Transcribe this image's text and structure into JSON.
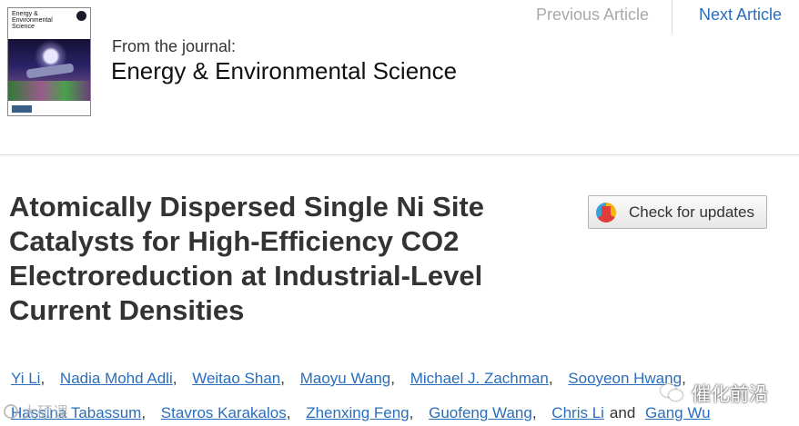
{
  "journal": {
    "cover_title": "Energy &\nEnvironmental\nScience",
    "from_label": "From the journal:",
    "name": "Energy & Environmental Science"
  },
  "nav": {
    "previous": "Previous Article",
    "next": "Next Article"
  },
  "article": {
    "title": "Atomically Dispersed Single Ni Site Catalysts for High-Efficiency CO2 Electroreduction at Industrial-Level Current Densities",
    "check_updates_label": "Check for updates"
  },
  "authors": {
    "list": [
      "Yi Li",
      "Nadia Mohd Adli",
      "Weitao Shan",
      "Maoyu Wang",
      "Michael J. Zachman",
      "Sooyeon Hwang",
      "Hassina Tabassum",
      "Stavros Karakalos",
      "Zhenxing Feng",
      "Guofeng Wang",
      "Chris Li",
      "Gang Wu"
    ],
    "separator": ",",
    "and_label": "and"
  },
  "watermarks": {
    "left_text": "大硕课",
    "right_text": "催化前沿"
  },
  "colors": {
    "link": "#2a6ebb",
    "disabled_link": "#a9a9a9",
    "title_text": "#333333"
  }
}
